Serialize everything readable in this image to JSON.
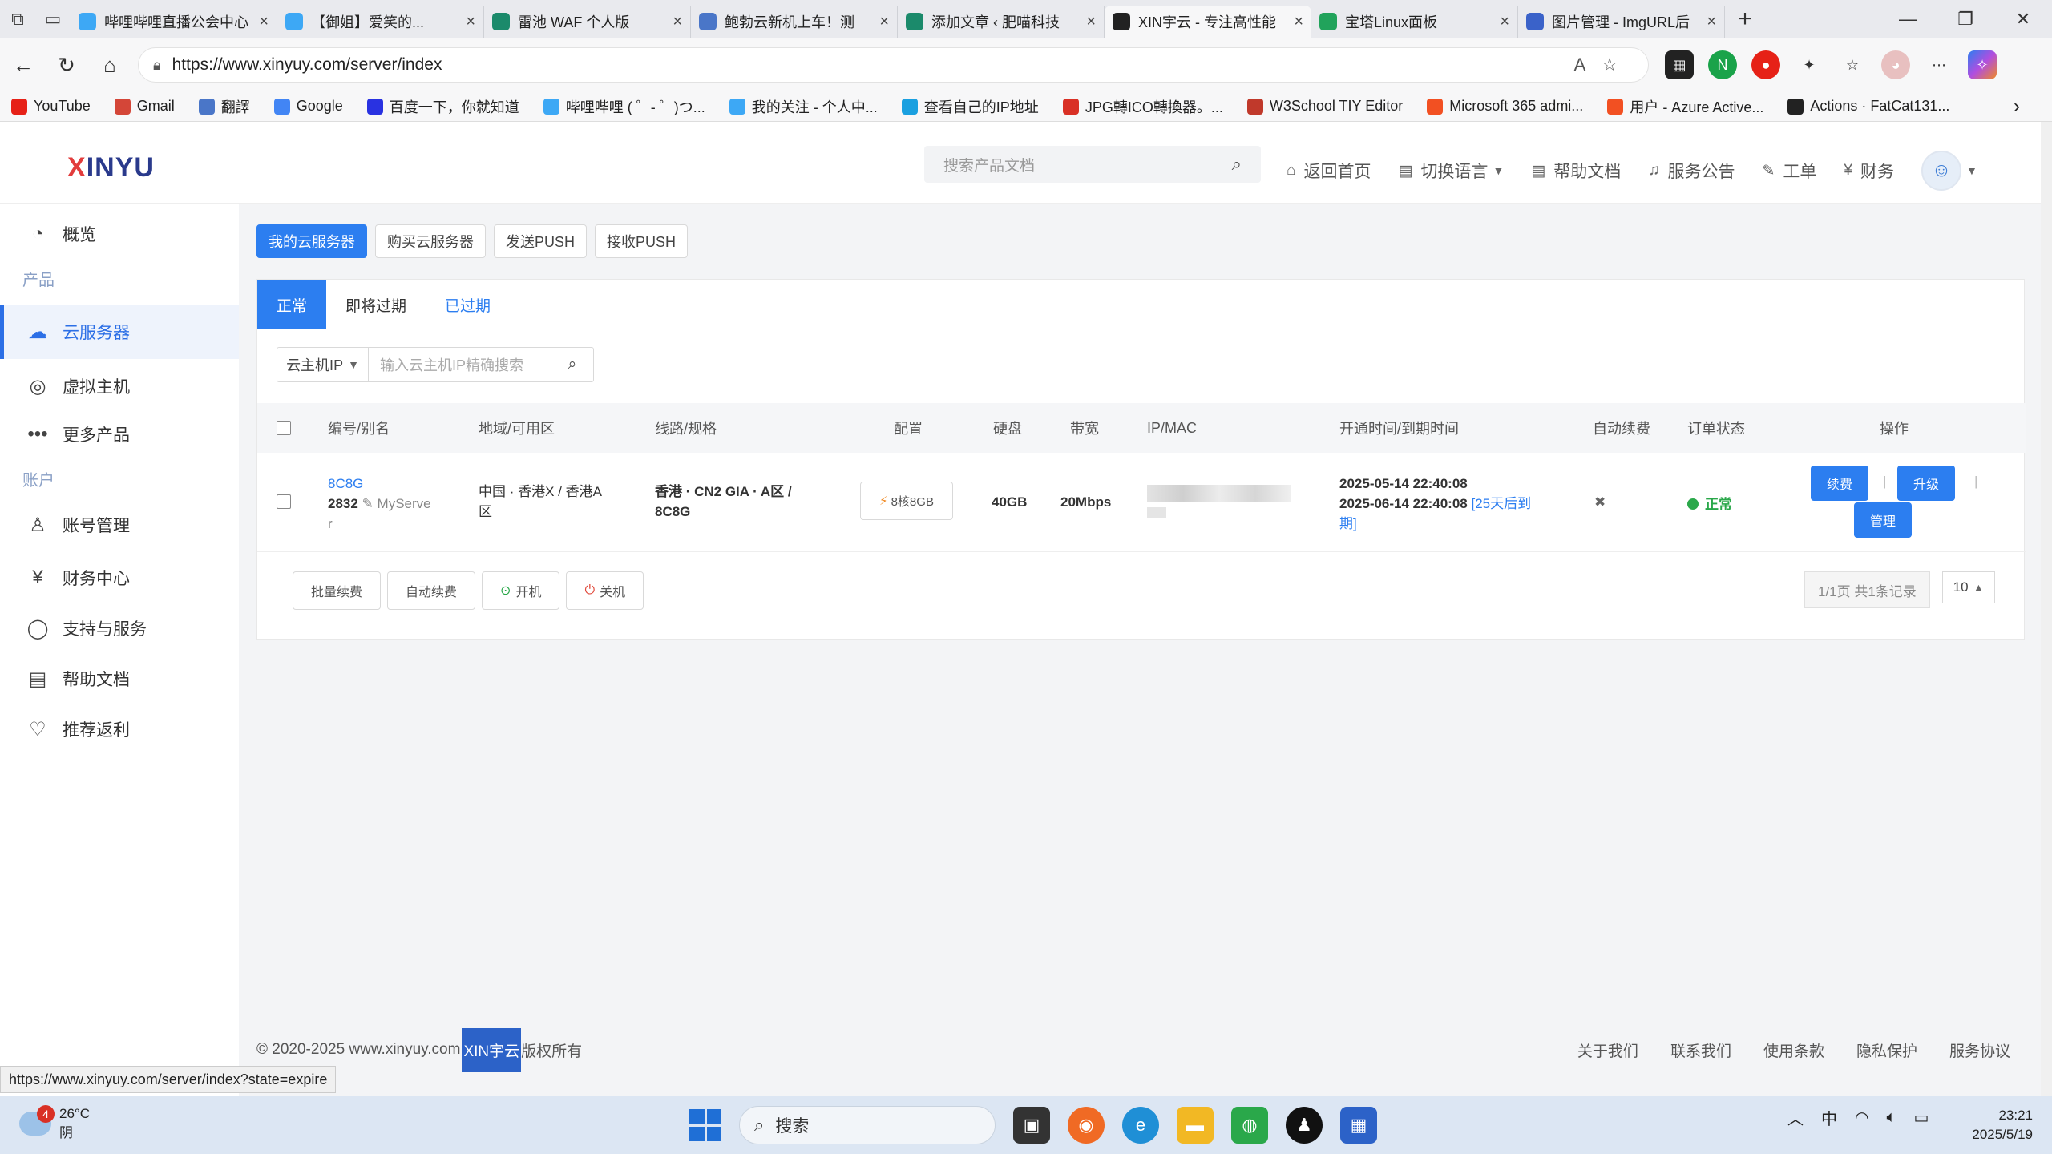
{
  "browser": {
    "tabs": [
      {
        "title": "哔哩哔哩直播公会中心",
        "color": "#3da8f5",
        "active": false
      },
      {
        "title": "【御姐】爱笑的...",
        "color": "#3da8f5",
        "active": false
      },
      {
        "title": "雷池 WAF 个人版",
        "color": "#1b8a6b",
        "active": false
      },
      {
        "title": "鲍勃云新机上车！测",
        "color": "#4a76c8",
        "active": false
      },
      {
        "title": "添加文章 ‹ 肥喵科技",
        "color": "#1b8a6b",
        "active": false
      },
      {
        "title": "XIN宇云 - 专注高性能",
        "color": "#222222",
        "active": true
      },
      {
        "title": "宝塔Linux面板",
        "color": "#21a35b",
        "active": false
      },
      {
        "title": "图片管理 - ImgURL后",
        "color": "#3a62c9",
        "active": false
      }
    ],
    "url": "https://www.xinyuy.com/server/index",
    "bookmarks": [
      {
        "label": "YouTube",
        "color": "#e62117"
      },
      {
        "label": "Gmail",
        "color": "#d44638"
      },
      {
        "label": "翻譯",
        "color": "#4a76c8"
      },
      {
        "label": "Google",
        "color": "#4285f4"
      },
      {
        "label": "百度一下，你就知道",
        "color": "#2932e1"
      },
      {
        "label": "哔哩哔哩 ( ゜- ゜)つ...",
        "color": "#3da8f5"
      },
      {
        "label": "我的关注 - 个人中...",
        "color": "#3da8f5"
      },
      {
        "label": "查看自己的IP地址",
        "color": "#1aa0e0"
      },
      {
        "label": "JPG轉ICO轉換器。...",
        "color": "#d93025"
      },
      {
        "label": "W3School TIY Editor",
        "color": "#c0392b"
      },
      {
        "label": "Microsoft 365 admi...",
        "color": "#f25022"
      },
      {
        "label": "用户 - Azure Active...",
        "color": "#f25022"
      },
      {
        "label": "Actions · FatCat131...",
        "color": "#222222"
      }
    ],
    "status_url": "https://www.xinyuy.com/server/index?state=expire"
  },
  "header": {
    "logo_x": "X",
    "logo_rest": "INYU",
    "search_placeholder": "搜索产品文档",
    "nav": [
      {
        "icon": "⌂",
        "label": "返回首页",
        "name": "home"
      },
      {
        "icon": "▤",
        "label": "切换语言",
        "name": "language",
        "caret": true
      },
      {
        "icon": "▤",
        "label": "帮助文档",
        "name": "docs"
      },
      {
        "icon": "♫",
        "label": "服务公告",
        "name": "announcements"
      },
      {
        "icon": "✎",
        "label": "工单",
        "name": "tickets"
      },
      {
        "icon": "¥",
        "label": "财务",
        "name": "finance"
      }
    ]
  },
  "sidebar": {
    "overview": "概览",
    "group_products": "产品",
    "cloud_server": "云服务器",
    "virtual_host": "虚拟主机",
    "more_products": "更多产品",
    "group_account": "账户",
    "account_manage": "账号管理",
    "finance_center": "财务中心",
    "support": "支持与服务",
    "help_docs": "帮助文档",
    "referral": "推荐返利"
  },
  "main": {
    "top_buttons": [
      "我的云服务器",
      "购买云服务器",
      "发送PUSH",
      "接收PUSH"
    ],
    "subtabs": [
      "正常",
      "即将过期",
      "已过期"
    ],
    "filter": {
      "select": "云主机IP",
      "placeholder": "输入云主机IP精确搜索"
    },
    "columns": [
      "编号/别名",
      "地域/可用区",
      "线路/规格",
      "配置",
      "硬盘",
      "带宽",
      "IP/MAC",
      "开通时间/到期时间",
      "自动续费",
      "订单状态",
      "操作"
    ],
    "row": {
      "code": "8C8G",
      "id": "2832",
      "alias_a": "MyServe",
      "alias_b": "r",
      "region_a": "中国 · 香港X / 香港A",
      "region_b": "区",
      "line_a": "香港 · CN2 GIA · A区 /",
      "line_b": "8C8G",
      "config": "8核8GB",
      "disk": "40GB",
      "bandwidth": "20Mbps",
      "open_time": "2025-05-14 22:40:08",
      "expire_time": "2025-06-14 22:40:08",
      "expire_note_a": "[25天后到",
      "expire_note_b": "期]",
      "auto_renew": "✖",
      "status": "正常",
      "actions": {
        "renew": "续费",
        "upgrade": "升级",
        "manage": "管理"
      }
    },
    "bulk_buttons": {
      "renew": "批量续费",
      "auto": "自动续费",
      "on": "开机",
      "off": "关机"
    },
    "pager": "1/1页 共1条记录",
    "page_size": "10"
  },
  "footer": {
    "copyright": "© 2020-2025 www.xinyuy.com",
    "brand": "XIN宇云",
    "rights": "版权所有",
    "links": [
      "关于我们",
      "联系我们",
      "使用条款",
      "隐私保护",
      "服务协议"
    ]
  },
  "taskbar": {
    "weather_badge": "4",
    "temp": "26°C",
    "cond": "阴",
    "search": "搜索",
    "ime": "中",
    "time": "23:21",
    "date": "2025/5/19"
  }
}
